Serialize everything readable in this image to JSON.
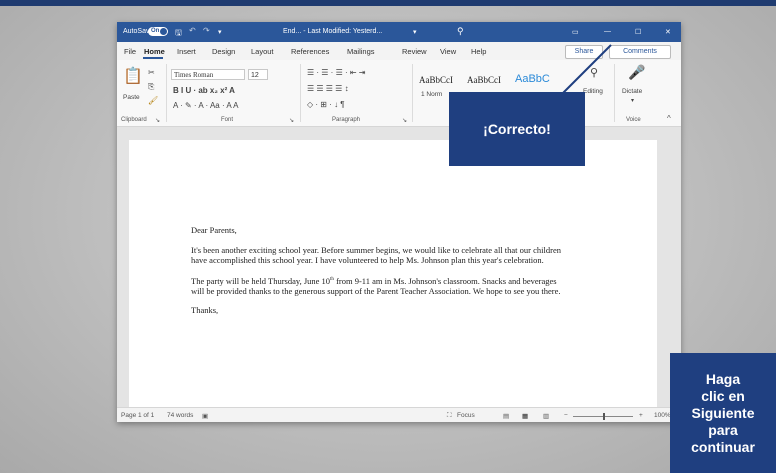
{
  "titlebar": {
    "autosave_label": "AutoSave",
    "autosave_state": "On",
    "doc_title": "End... - Last Modified: Yesterd...",
    "search_glyph": "⚲",
    "window_controls": [
      "▭",
      "—",
      "☐",
      "✕"
    ]
  },
  "menu": {
    "tabs": [
      "File",
      "Home",
      "Insert",
      "Design",
      "Layout",
      "References",
      "Mailings",
      "Review",
      "View",
      "Help"
    ],
    "share_label": "Share",
    "comments_label": "Comments"
  },
  "ribbon": {
    "clipboard": {
      "paste_label": "Paste",
      "group_label": "Clipboard"
    },
    "font": {
      "font_name": "Times Roman",
      "font_size": "12",
      "group_label": "Font",
      "format_buttons": "B  I  U  ·  ab  x₂  x²  A",
      "color_buttons": "A  ·  ✎  ·  A  ·  Aa  ·  A  A"
    },
    "paragraph": {
      "group_label": "Paragraph",
      "row1": "☰  ·  ☰  ·  ☰  ·  ⇤  ⇥",
      "row2": "☰  ☰  ☰  ☰  ↕",
      "row3": "◇  ·  ⊞  ·  ↓  ¶"
    },
    "styles": {
      "style1": "AaBbCcI",
      "style2": "AaBbCcI",
      "style3": "AaBbC",
      "normal_label": "1 Norm"
    },
    "editing_label": "Editing",
    "voice": {
      "dictate_label": "Dictate",
      "group_label": "Voice"
    }
  },
  "document": {
    "greeting": "Dear Parents,",
    "para1": "It's been another exciting school year. Before summer begins, we would like to celebrate all that our children have accomplished this school year. I have volunteered to help Ms. Johnson plan this year's celebration.",
    "para2_before": "The party will be held Thursday, June 10",
    "para2_sup": "th",
    "para2_after": " from 9-11 am in Ms. Johnson's classroom. Snacks and beverages will be provided thanks to the generous support of the Parent Teacher Association. We hope to see you there.",
    "closing": "Thanks,"
  },
  "status": {
    "page": "Page 1 of 1",
    "words": "74 words",
    "focus": "Focus",
    "zoom": "100%"
  },
  "overlay": {
    "callout_text": "¡Correcto!",
    "next_lines": [
      "Haga",
      "clic en",
      "Siguiente",
      "para",
      "continuar"
    ]
  },
  "colors": {
    "word_blue": "#2b579a",
    "callout_blue": "#1f3f80"
  }
}
